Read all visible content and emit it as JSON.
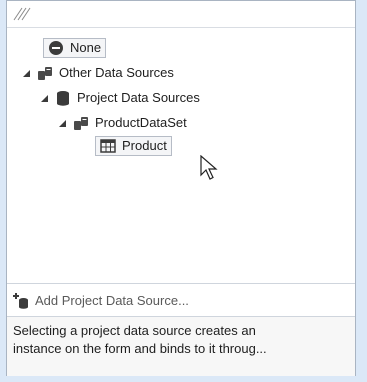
{
  "tree": {
    "items": [
      {
        "label": "None",
        "icon": "none-circle-icon"
      },
      {
        "label": "Other Data Sources",
        "icon": "data-sources-icon"
      },
      {
        "label": "Project Data Sources",
        "icon": "database-icon"
      },
      {
        "label": "ProductDataSet",
        "icon": "dataset-icon"
      },
      {
        "label": "Product",
        "icon": "table-icon"
      }
    ]
  },
  "footer": {
    "add_label": "Add Project Data Source...",
    "description_line1": "Selecting a project data source creates an",
    "description_line2": "instance on the form and binds to it throug..."
  },
  "colors": {
    "background": "#dbe8f7",
    "panel": "#ffffff",
    "border": "#a9b4c2"
  }
}
